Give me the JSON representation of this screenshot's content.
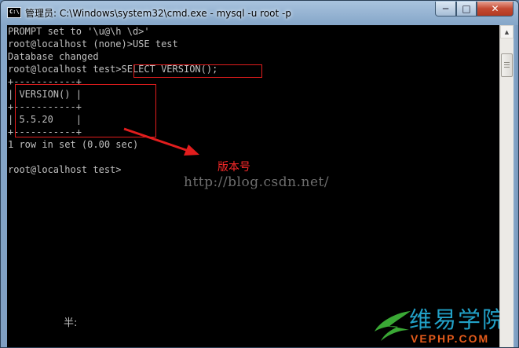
{
  "window": {
    "title": "管理员: C:\\Windows\\system32\\cmd.exe - mysql  -u root -p",
    "icon_glyph": "C:\\",
    "minimize_glyph": "─",
    "maximize_glyph": "□",
    "close_glyph": "✕"
  },
  "console": {
    "lines": [
      "PROMPT set to '\\u@\\h \\d>'",
      "root@localhost (none)>USE test",
      "Database changed",
      "root@localhost test>SELECT VERSION();",
      "+-----------+",
      "| VERSION() |",
      "+-----------+",
      "| 5.5.20    |",
      "+-----------+",
      "1 row in set (0.00 sec)",
      "",
      "root@localhost test>"
    ],
    "ime_status": "半:"
  },
  "annotation": {
    "label": "版本号",
    "color": "#e21d1d"
  },
  "watermark": {
    "text": "http://blog.csdn.net/"
  },
  "logo": {
    "cn": "维易学院",
    "en": "VEPHP.COM",
    "cn_color": "#22a1c7",
    "en_color": "#e55b1b",
    "swoosh_color": "#3aa835"
  },
  "scrollbar": {
    "up_glyph": "▲"
  }
}
